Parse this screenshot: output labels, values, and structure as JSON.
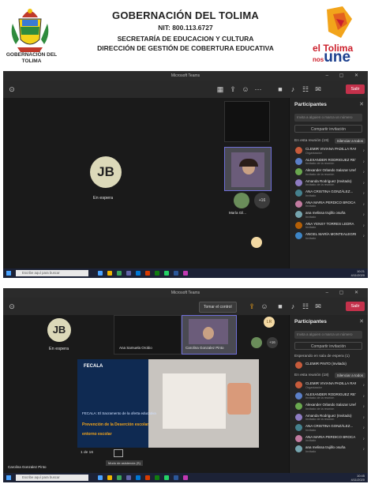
{
  "header": {
    "crest_caption": "GOBERNACIÓN DEL TOLIMA",
    "title": "GOBERNACIÓN DEL TOLIMA",
    "nit": "NIT: 800.113.6727",
    "secretaria": "SECRETARÍA DE EDUCACION Y CULTURA",
    "direccion": "DIRECCIÓN DE GESTIÓN DE COBERTURA EDUCATIVA",
    "brand_top": "el Tolima",
    "brand_nos": "nos",
    "brand_une": "une"
  },
  "colors": {
    "teams_dark": "#1f1f1f",
    "leave_red": "#c4314b",
    "accent": "#6f6fd8",
    "taskbar": "#1c2236"
  },
  "screen1": {
    "window_title": "Microsoft Teams",
    "leave_label": "Salir",
    "avatar_initials": "JB",
    "avatar_caption": "En espera",
    "small_tile_caption": "María Gil...",
    "plus_count": "+16",
    "panel": {
      "title": "Participantes",
      "search_placeholder": "Invita a alguien o marca un número",
      "share_label": "Compartir invitación",
      "section_label": "En esta reunión (19)",
      "mute_all": "Silenciar a todos",
      "participants": [
        {
          "name": "CLEMIR VIVIANA PADILLA RAMI...",
          "sub": "Organizador",
          "color": "#c75b3b"
        },
        {
          "name": "ALEXANDER RODRIGUEZ RETIRA...",
          "sub": "Invitado de la reunión",
          "color": "#5b7fc7"
        },
        {
          "name": "Alexander Orlando Salazar Ureña...",
          "sub": "Invitado de la reunión",
          "color": "#6aa84f"
        },
        {
          "name": "Amanda Rodriguez (Invitado)",
          "sub": "Invitado de la reunión",
          "color": "#8e7cc3"
        },
        {
          "name": "ANA CRISTINA GONZÁLEZ...",
          "sub": "Invitado",
          "color": "#45818e"
        },
        {
          "name": "ANA MARIA PERDICO BROCA",
          "sub": "Invitado",
          "color": "#c27ba0"
        },
        {
          "name": "ana melissa trujillo osuña",
          "sub": "Invitado",
          "color": "#76a5af"
        },
        {
          "name": "ANA YENSY TORRES LEDRA",
          "sub": "Invitado",
          "color": "#b45f06"
        },
        {
          "name": "ANGEL MARÍA MONTEALEGRE...",
          "sub": "Invitado",
          "color": "#3d85c6"
        }
      ]
    },
    "taskbar": {
      "search_text": "Escribe aquí para buscar",
      "time": "10:21",
      "date": "4/11/2020"
    }
  },
  "screen2": {
    "window_title": "Microsoft Teams",
    "top_button": "Tomar el control",
    "leave_label": "Salir",
    "avatar_initials": "JB",
    "avatar_caption": "En espera",
    "tile2_caption": "Ana Samuela Orobio",
    "tile3_caption": "Carolina Gonzalez Pinto",
    "lr_initials": "LR",
    "plus_count": "+16",
    "slide_logo": "FECALA",
    "slide_line1": "FECALA: El Sacramento de la oferta educativa",
    "slide_line2": "Prevención de la Deserción escolar",
    "slide_line3": "entorno escolar",
    "page_indicator": "1 de 16",
    "presenter": "Carolina Gonzalez Pinto",
    "share_caption": "Modo de asistencia (S)",
    "panel": {
      "title": "Participantes",
      "search_placeholder": "Invita a alguien o marca un número",
      "share_label": "Compartir invitación",
      "lobby_label": "Esperando en sala de espera (1)",
      "lobby_person": "CLEMIR PINTO (Invitado)",
      "section_label": "En esta reunión (18)",
      "mute_all": "Silenciar a todos",
      "participants": [
        {
          "name": "CLEMIR VIVIANA PADILLA RAMI...",
          "sub": "Organizador",
          "color": "#c75b3b"
        },
        {
          "name": "ALEXANDER RODRIGUEZ RETIRA...",
          "sub": "Invitado de la reunión",
          "color": "#5b7fc7"
        },
        {
          "name": "Alexander Orlando Salazar Ureña...",
          "sub": "Invitado de la reunión",
          "color": "#6aa84f"
        },
        {
          "name": "Amanda Rodriguez (Invitado)",
          "sub": "Invitado de la reunión",
          "color": "#8e7cc3"
        },
        {
          "name": "ANA CRISTINA GONZÁLEZ...",
          "sub": "Invitado",
          "color": "#45818e"
        },
        {
          "name": "ANA MARIA PERDICO BROCA",
          "sub": "Invitado",
          "color": "#c27ba0"
        },
        {
          "name": "ana melissa trujillo osuña",
          "sub": "Invitado",
          "color": "#76a5af"
        }
      ]
    },
    "taskbar": {
      "search_text": "Escribe aquí para buscar",
      "time": "10:45",
      "date": "4/11/2020"
    }
  }
}
